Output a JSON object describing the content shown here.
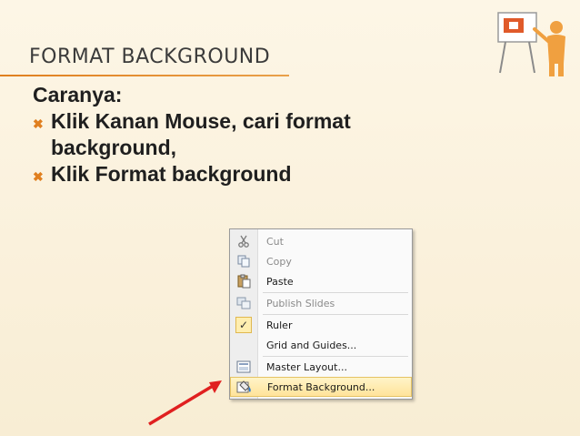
{
  "slide": {
    "title": "FORMAT BACKGROUND",
    "intro": "Caranya:",
    "bullets": [
      "Klik Kanan Mouse, cari format background,",
      "Klik Format background"
    ]
  },
  "context_menu": {
    "items": [
      {
        "label": "Cut",
        "icon": "scissors-icon",
        "disabled": true
      },
      {
        "label": "Copy",
        "icon": "copy-icon",
        "disabled": true
      },
      {
        "label": "Paste",
        "icon": "paste-icon",
        "disabled": false
      },
      {
        "label": "Publish Slides",
        "icon": "publish-icon",
        "disabled": true
      },
      {
        "label": "Ruler",
        "icon": "checkmark-icon",
        "disabled": false
      },
      {
        "label": "Grid and Guides...",
        "icon": "",
        "disabled": false
      },
      {
        "label": "Master Layout...",
        "icon": "layout-icon",
        "disabled": false
      },
      {
        "label": "Format Background...",
        "icon": "format-background-icon",
        "disabled": false,
        "selected": true
      }
    ]
  },
  "colors": {
    "accent": "#e07f1f",
    "arrow": "#e02020",
    "highlight": "#ffe39a"
  }
}
